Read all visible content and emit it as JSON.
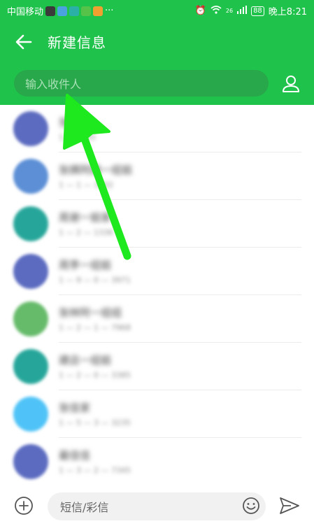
{
  "status_bar": {
    "carrier": "中国移动",
    "more": "···",
    "network": "26",
    "battery": "88",
    "time": "晚上8:21",
    "notification_icons": [
      "gallery-icon",
      "browser-icon",
      "video-icon",
      "maps-icon"
    ]
  },
  "header": {
    "title": "新建信息"
  },
  "recipient": {
    "placeholder": "输入收件人"
  },
  "contacts": [
    {
      "name": "张三",
      "sub": "1 — 7345",
      "avatar_color": "#5c6bc0"
    },
    {
      "name": "张姨阿姨一组姐",
      "sub": "1 — 1 — 3302",
      "avatar_color": "#5c8fd6"
    },
    {
      "name": "周谢一姐家",
      "sub": "1 — 2 — 1336",
      "avatar_color": "#26a69a"
    },
    {
      "name": "周李一组姐",
      "sub": "1 — 9 — 0 — 3971",
      "avatar_color": "#5c6bc0"
    },
    {
      "name": "张林阿一组组",
      "sub": "1 — 2 — 1 — 7968",
      "avatar_color": "#66bb6a"
    },
    {
      "name": "建店一组姐",
      "sub": "1 — 2 — 0 — 3385",
      "avatar_color": "#26a69a"
    },
    {
      "name": "张佳家",
      "sub": "1 — 5 — 3 — 3235",
      "avatar_color": "#4fc3f7"
    },
    {
      "name": "最佳佳",
      "sub": "1 — 3 — 2 — 7345",
      "avatar_color": "#5c6bc0"
    }
  ],
  "composer": {
    "placeholder": "短信/彩信"
  },
  "colors": {
    "header_green": "#1fc24a",
    "annotation_arrow": "#1ee81e"
  }
}
